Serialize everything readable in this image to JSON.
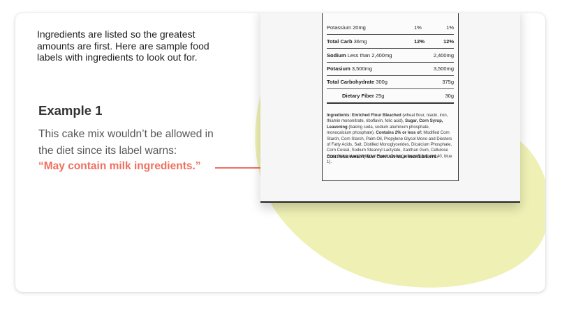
{
  "intro_text": "Ingredients are listed so the greatest amounts are first. Here are sample food labels with ingredients to look out for.",
  "example": {
    "title": "Example 1",
    "body": "This cake mix wouldn’t be allowed in the diet since its label warns:",
    "warning": "“May contain milk ingredients.”"
  },
  "label": {
    "rows": [
      {
        "name_bold": "",
        "name": "Potassium 20mg",
        "c1": "1%",
        "c2": "1%"
      },
      {
        "name_bold": "Total Carb",
        "name": " 36mg",
        "c1": "12%",
        "c2": "12%"
      },
      {
        "name_bold": "Sodium",
        "name": " Less than 2,400mg",
        "v": "2,400mg"
      },
      {
        "name_bold": "Potasium",
        "name": " 3,500mg",
        "v": "3,500mg"
      },
      {
        "name_bold": "Total Carbohydrate",
        "name": " 300g",
        "v": "375g"
      },
      {
        "name_bold": "Dietary Fiber",
        "name": " 25g",
        "v": "30g"
      }
    ],
    "ingredients_heading": "Ingredients: Enriched Flour Bleached",
    "ingredients_text": "(wheat flour, niacin, iron, thiamin mononitrate, riboflavin, folic acid),",
    "sugar": "Sugar, Corn Syrup, Leavening",
    "leavening_text": "(baking soda, sodium aluminum phosphate, monocalcium phosphate).",
    "contains_2pct": "Contains 2% or less of:",
    "rest_text": "Modified Corn Starch, Corn Starch, Palm Oil, Propylene Glycol Mono and Diesters of Fatty Acids, Salt, Distilled Monoglycerides, Dicalcium Phosphate, Corn Cereal, Sodium Stearoyl Lactylate, Xanthan Gum, Cellulose Gum, Natural and Artificial Flavor, Color (yellows 5 & 6, red 40, blue 1).",
    "allergen_warning": "CONTAINS WHEAT; MAY CONTAIN MILK INGREDIENTS."
  },
  "colors": {
    "accent": "#ef6f5f",
    "blob": "#eef0b4"
  }
}
